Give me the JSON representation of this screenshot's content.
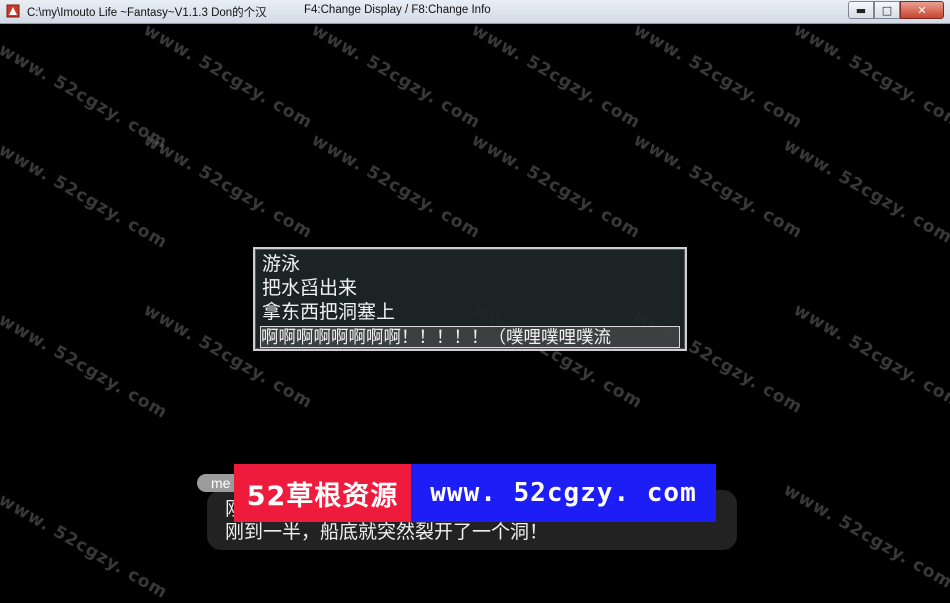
{
  "window": {
    "title": "C:\\my\\Imouto Life ~Fantasy~V1.1.3 Don的个汉",
    "hint": "F4:Change Display / F8:Change Info",
    "controls": {
      "minimize": "▬",
      "maximize": "□",
      "close": "✕"
    },
    "accent": "#cc3b2a"
  },
  "watermark": {
    "text": "www. 52cgzy. com"
  },
  "choices": {
    "items": [
      "游泳",
      "把水舀出来",
      "拿东西把洞塞上",
      "啊啊啊啊啊啊啊啊！！！！！（噗哩噗哩噗流"
    ],
    "selected_index": 3
  },
  "message": {
    "speaker": "me",
    "line1": "刚",
    "line2": "刚到一半，船底就突然裂开了一个洞！"
  },
  "banner": {
    "left_text": "52草根资源",
    "right_text": "www. 52cgzy. com",
    "left_color": "#ee1b3c",
    "right_color": "#1d1df5"
  }
}
